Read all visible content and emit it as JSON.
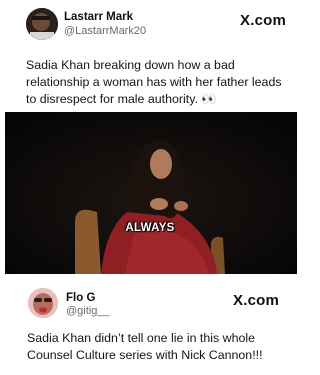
{
  "tweet1": {
    "name": "Lastarr Mark",
    "handle": "@LastarrMark20",
    "site_logo": "X.com",
    "text": "Sadia Khan breaking down how a bad relationship a woman has with her father leads to disrespect for male authority. 👀",
    "video_caption": "ALWAYS"
  },
  "tweet2": {
    "name": "Flo G",
    "handle": "@gitig__",
    "site_logo": "X.com",
    "text": "Sadia Khan didn’t tell one lie in this whole Counsel Culture series with Nick Cannon!!!"
  }
}
